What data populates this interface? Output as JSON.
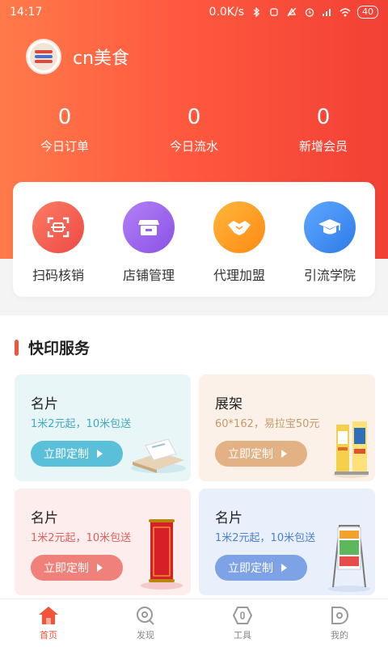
{
  "status_bar": {
    "time": "14:17",
    "net_speed": "0.0K/s",
    "battery": "40"
  },
  "profile": {
    "shop_name": "cn美食"
  },
  "stats": [
    {
      "value": "0",
      "label": "今日订单"
    },
    {
      "value": "0",
      "label": "今日流水"
    },
    {
      "value": "0",
      "label": "新增会员"
    }
  ],
  "quick_actions": [
    {
      "label": "扫码核销",
      "icon": "scan-icon",
      "color": "#f25a4c"
    },
    {
      "label": "店铺管理",
      "icon": "store-icon",
      "color": "#9b62ec"
    },
    {
      "label": "代理加盟",
      "icon": "handshake-icon",
      "color": "#ff9a1f"
    },
    {
      "label": "引流学院",
      "icon": "graduation-cap-icon",
      "color": "#3f8ef1"
    }
  ],
  "services": {
    "title": "快印服务",
    "cards": [
      {
        "title": "名片",
        "subtitle": "1米2元起，10米包送",
        "button": "立即定制",
        "bg": "#e8f6f7",
        "sub_color": "#42a9c3",
        "btn_color": "#5ac0d9",
        "art": "business-card-stack-icon"
      },
      {
        "title": "展架",
        "subtitle": "60*162，易拉宝50元",
        "button": "立即定制",
        "bg": "#fbf1e9",
        "sub_color": "#c49a6c",
        "btn_color": "#e2b285",
        "art": "rollup-banner-icon"
      },
      {
        "title": "名片",
        "subtitle": "1米2元起，10米包送",
        "button": "立即定制",
        "bg": "#fdeded",
        "sub_color": "#e0605c",
        "btn_color": "#f0807a",
        "art": "red-scroll-banner-icon"
      },
      {
        "title": "名片",
        "subtitle": "1米2元起，10米包送",
        "button": "立即定制",
        "bg": "#eaf0fb",
        "sub_color": "#4a7fd6",
        "btn_color": "#7ea2e6",
        "art": "aframe-poster-stand-icon"
      }
    ]
  },
  "tabbar": [
    {
      "label": "首页",
      "icon": "home-icon",
      "active": true
    },
    {
      "label": "发现",
      "icon": "discover-icon",
      "active": false
    },
    {
      "label": "工具",
      "icon": "tools-icon",
      "active": false
    },
    {
      "label": "我的",
      "icon": "profile-icon",
      "active": false
    }
  ]
}
